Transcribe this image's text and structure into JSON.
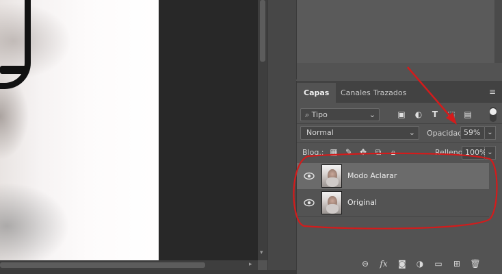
{
  "tabs": [
    {
      "label": "Capas",
      "active": true
    },
    {
      "label": "Canales",
      "active": false
    },
    {
      "label": "Trazados",
      "active": false
    }
  ],
  "filter": {
    "label": "Tipo",
    "prefix_icon": "search-icon"
  },
  "filter_icons": [
    "image-icon",
    "adjustment-icon",
    "type-icon",
    "shape-icon",
    "smart-object-icon"
  ],
  "blend_mode": "Normal",
  "opacity": {
    "label": "Opacidad:",
    "value": "59%"
  },
  "lock": {
    "label": "Bloq.:",
    "icons": [
      "lock-transparent-icon",
      "lock-paint-icon",
      "lock-position-icon",
      "lock-artboard-icon",
      "lock-all-icon"
    ]
  },
  "fill": {
    "label": "Relleno:",
    "value": "100%"
  },
  "layers": [
    {
      "name": "Modo Aclarar",
      "selected": true,
      "visible": true
    },
    {
      "name": "Original",
      "selected": false,
      "visible": true
    }
  ],
  "footer_icons": [
    "link-icon",
    "fx-icon",
    "mask-icon",
    "adjustment-layer-icon",
    "folder-icon",
    "new-layer-icon",
    "trash-icon"
  ],
  "colors": {
    "annotation": "#d41b1b",
    "panel": "#535353",
    "selected_row": "#6b6b6b"
  }
}
